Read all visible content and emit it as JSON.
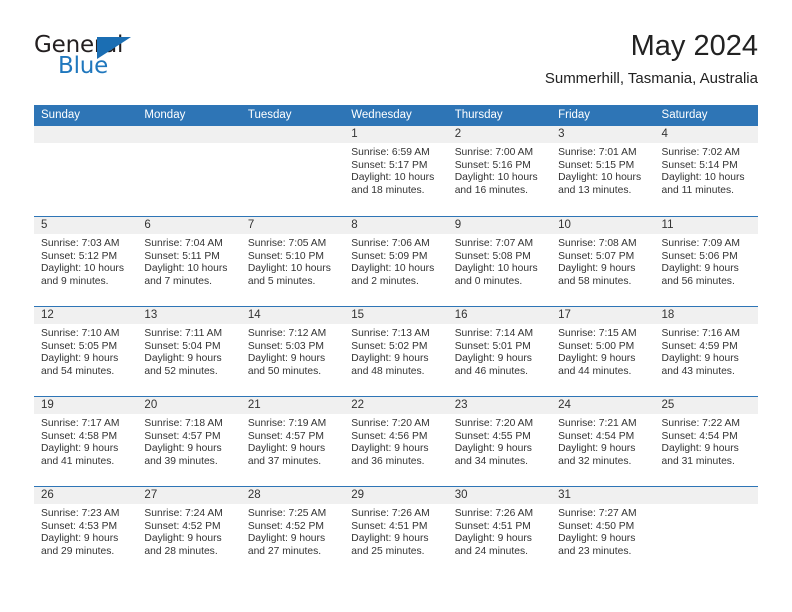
{
  "brand": {
    "word_one": "General",
    "word_two": "Blue",
    "accent_color": "#1b6eb3"
  },
  "header": {
    "title": "May 2024",
    "location": "Summerhill, Tasmania, Australia"
  },
  "theme": {
    "header_blue": "#2e75b6",
    "daynum_band": "#f0f0f0",
    "text": "#333333"
  },
  "weekdays": [
    "Sunday",
    "Monday",
    "Tuesday",
    "Wednesday",
    "Thursday",
    "Friday",
    "Saturday"
  ],
  "weeks": [
    [
      {
        "day": "",
        "sunrise": "",
        "sunset": "",
        "daylight_1": "",
        "daylight_2": ""
      },
      {
        "day": "",
        "sunrise": "",
        "sunset": "",
        "daylight_1": "",
        "daylight_2": ""
      },
      {
        "day": "",
        "sunrise": "",
        "sunset": "",
        "daylight_1": "",
        "daylight_2": ""
      },
      {
        "day": "1",
        "sunrise": "Sunrise: 6:59 AM",
        "sunset": "Sunset: 5:17 PM",
        "daylight_1": "Daylight: 10 hours",
        "daylight_2": "and 18 minutes."
      },
      {
        "day": "2",
        "sunrise": "Sunrise: 7:00 AM",
        "sunset": "Sunset: 5:16 PM",
        "daylight_1": "Daylight: 10 hours",
        "daylight_2": "and 16 minutes."
      },
      {
        "day": "3",
        "sunrise": "Sunrise: 7:01 AM",
        "sunset": "Sunset: 5:15 PM",
        "daylight_1": "Daylight: 10 hours",
        "daylight_2": "and 13 minutes."
      },
      {
        "day": "4",
        "sunrise": "Sunrise: 7:02 AM",
        "sunset": "Sunset: 5:14 PM",
        "daylight_1": "Daylight: 10 hours",
        "daylight_2": "and 11 minutes."
      }
    ],
    [
      {
        "day": "5",
        "sunrise": "Sunrise: 7:03 AM",
        "sunset": "Sunset: 5:12 PM",
        "daylight_1": "Daylight: 10 hours",
        "daylight_2": "and 9 minutes."
      },
      {
        "day": "6",
        "sunrise": "Sunrise: 7:04 AM",
        "sunset": "Sunset: 5:11 PM",
        "daylight_1": "Daylight: 10 hours",
        "daylight_2": "and 7 minutes."
      },
      {
        "day": "7",
        "sunrise": "Sunrise: 7:05 AM",
        "sunset": "Sunset: 5:10 PM",
        "daylight_1": "Daylight: 10 hours",
        "daylight_2": "and 5 minutes."
      },
      {
        "day": "8",
        "sunrise": "Sunrise: 7:06 AM",
        "sunset": "Sunset: 5:09 PM",
        "daylight_1": "Daylight: 10 hours",
        "daylight_2": "and 2 minutes."
      },
      {
        "day": "9",
        "sunrise": "Sunrise: 7:07 AM",
        "sunset": "Sunset: 5:08 PM",
        "daylight_1": "Daylight: 10 hours",
        "daylight_2": "and 0 minutes."
      },
      {
        "day": "10",
        "sunrise": "Sunrise: 7:08 AM",
        "sunset": "Sunset: 5:07 PM",
        "daylight_1": "Daylight: 9 hours",
        "daylight_2": "and 58 minutes."
      },
      {
        "day": "11",
        "sunrise": "Sunrise: 7:09 AM",
        "sunset": "Sunset: 5:06 PM",
        "daylight_1": "Daylight: 9 hours",
        "daylight_2": "and 56 minutes."
      }
    ],
    [
      {
        "day": "12",
        "sunrise": "Sunrise: 7:10 AM",
        "sunset": "Sunset: 5:05 PM",
        "daylight_1": "Daylight: 9 hours",
        "daylight_2": "and 54 minutes."
      },
      {
        "day": "13",
        "sunrise": "Sunrise: 7:11 AM",
        "sunset": "Sunset: 5:04 PM",
        "daylight_1": "Daylight: 9 hours",
        "daylight_2": "and 52 minutes."
      },
      {
        "day": "14",
        "sunrise": "Sunrise: 7:12 AM",
        "sunset": "Sunset: 5:03 PM",
        "daylight_1": "Daylight: 9 hours",
        "daylight_2": "and 50 minutes."
      },
      {
        "day": "15",
        "sunrise": "Sunrise: 7:13 AM",
        "sunset": "Sunset: 5:02 PM",
        "daylight_1": "Daylight: 9 hours",
        "daylight_2": "and 48 minutes."
      },
      {
        "day": "16",
        "sunrise": "Sunrise: 7:14 AM",
        "sunset": "Sunset: 5:01 PM",
        "daylight_1": "Daylight: 9 hours",
        "daylight_2": "and 46 minutes."
      },
      {
        "day": "17",
        "sunrise": "Sunrise: 7:15 AM",
        "sunset": "Sunset: 5:00 PM",
        "daylight_1": "Daylight: 9 hours",
        "daylight_2": "and 44 minutes."
      },
      {
        "day": "18",
        "sunrise": "Sunrise: 7:16 AM",
        "sunset": "Sunset: 4:59 PM",
        "daylight_1": "Daylight: 9 hours",
        "daylight_2": "and 43 minutes."
      }
    ],
    [
      {
        "day": "19",
        "sunrise": "Sunrise: 7:17 AM",
        "sunset": "Sunset: 4:58 PM",
        "daylight_1": "Daylight: 9 hours",
        "daylight_2": "and 41 minutes."
      },
      {
        "day": "20",
        "sunrise": "Sunrise: 7:18 AM",
        "sunset": "Sunset: 4:57 PM",
        "daylight_1": "Daylight: 9 hours",
        "daylight_2": "and 39 minutes."
      },
      {
        "day": "21",
        "sunrise": "Sunrise: 7:19 AM",
        "sunset": "Sunset: 4:57 PM",
        "daylight_1": "Daylight: 9 hours",
        "daylight_2": "and 37 minutes."
      },
      {
        "day": "22",
        "sunrise": "Sunrise: 7:20 AM",
        "sunset": "Sunset: 4:56 PM",
        "daylight_1": "Daylight: 9 hours",
        "daylight_2": "and 36 minutes."
      },
      {
        "day": "23",
        "sunrise": "Sunrise: 7:20 AM",
        "sunset": "Sunset: 4:55 PM",
        "daylight_1": "Daylight: 9 hours",
        "daylight_2": "and 34 minutes."
      },
      {
        "day": "24",
        "sunrise": "Sunrise: 7:21 AM",
        "sunset": "Sunset: 4:54 PM",
        "daylight_1": "Daylight: 9 hours",
        "daylight_2": "and 32 minutes."
      },
      {
        "day": "25",
        "sunrise": "Sunrise: 7:22 AM",
        "sunset": "Sunset: 4:54 PM",
        "daylight_1": "Daylight: 9 hours",
        "daylight_2": "and 31 minutes."
      }
    ],
    [
      {
        "day": "26",
        "sunrise": "Sunrise: 7:23 AM",
        "sunset": "Sunset: 4:53 PM",
        "daylight_1": "Daylight: 9 hours",
        "daylight_2": "and 29 minutes."
      },
      {
        "day": "27",
        "sunrise": "Sunrise: 7:24 AM",
        "sunset": "Sunset: 4:52 PM",
        "daylight_1": "Daylight: 9 hours",
        "daylight_2": "and 28 minutes."
      },
      {
        "day": "28",
        "sunrise": "Sunrise: 7:25 AM",
        "sunset": "Sunset: 4:52 PM",
        "daylight_1": "Daylight: 9 hours",
        "daylight_2": "and 27 minutes."
      },
      {
        "day": "29",
        "sunrise": "Sunrise: 7:26 AM",
        "sunset": "Sunset: 4:51 PM",
        "daylight_1": "Daylight: 9 hours",
        "daylight_2": "and 25 minutes."
      },
      {
        "day": "30",
        "sunrise": "Sunrise: 7:26 AM",
        "sunset": "Sunset: 4:51 PM",
        "daylight_1": "Daylight: 9 hours",
        "daylight_2": "and 24 minutes."
      },
      {
        "day": "31",
        "sunrise": "Sunrise: 7:27 AM",
        "sunset": "Sunset: 4:50 PM",
        "daylight_1": "Daylight: 9 hours",
        "daylight_2": "and 23 minutes."
      },
      {
        "day": "",
        "sunrise": "",
        "sunset": "",
        "daylight_1": "",
        "daylight_2": ""
      }
    ]
  ]
}
